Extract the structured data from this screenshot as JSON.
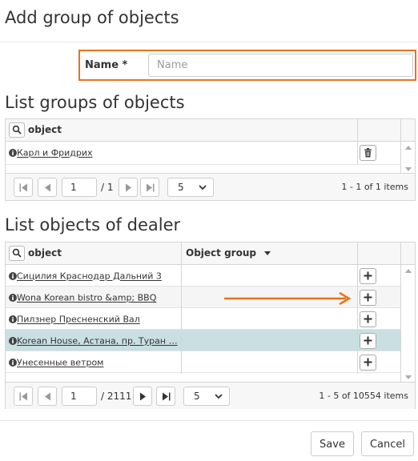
{
  "dialog": {
    "title": "Add group of objects"
  },
  "name_field": {
    "label": "Name *",
    "placeholder": "Name",
    "value": ""
  },
  "groups": {
    "title": "List groups of objects",
    "column_object": "object",
    "rows": [
      {
        "object": "Карл и Фридрих"
      }
    ],
    "pager": {
      "page": "1",
      "of_pages": "/ 1",
      "page_size": "5",
      "info": "1 - 1 of 1 items"
    }
  },
  "objects": {
    "title": "List objects of dealer",
    "column_object": "object",
    "column_group": "Object group",
    "rows": [
      {
        "object": "Сицилия Краснодар Дальний 3",
        "group": ""
      },
      {
        "object": "Wona Korean bistro &amp; BBQ",
        "group": ""
      },
      {
        "object": "Пилзнер Пресненский Вал",
        "group": ""
      },
      {
        "object": "Korean House, Астана, пр. Туран …",
        "group": ""
      },
      {
        "object": "Унесенные ветром",
        "group": ""
      }
    ],
    "selected_row": 3,
    "pager": {
      "page": "1",
      "of_pages": "/ 2111",
      "page_size": "5",
      "info": "1 - 5 of 10554 items"
    }
  },
  "footer": {
    "save_label": "Save",
    "cancel_label": "Cancel"
  },
  "colors": {
    "highlight": "#e8731a",
    "selected_row": "#c9dfe2"
  },
  "icons": [
    "search-icon",
    "info-icon",
    "trash-icon",
    "plus-icon",
    "first-page-icon",
    "prev-page-icon",
    "next-page-icon",
    "last-page-icon",
    "chevron-down-icon",
    "arrow-right-icon"
  ]
}
